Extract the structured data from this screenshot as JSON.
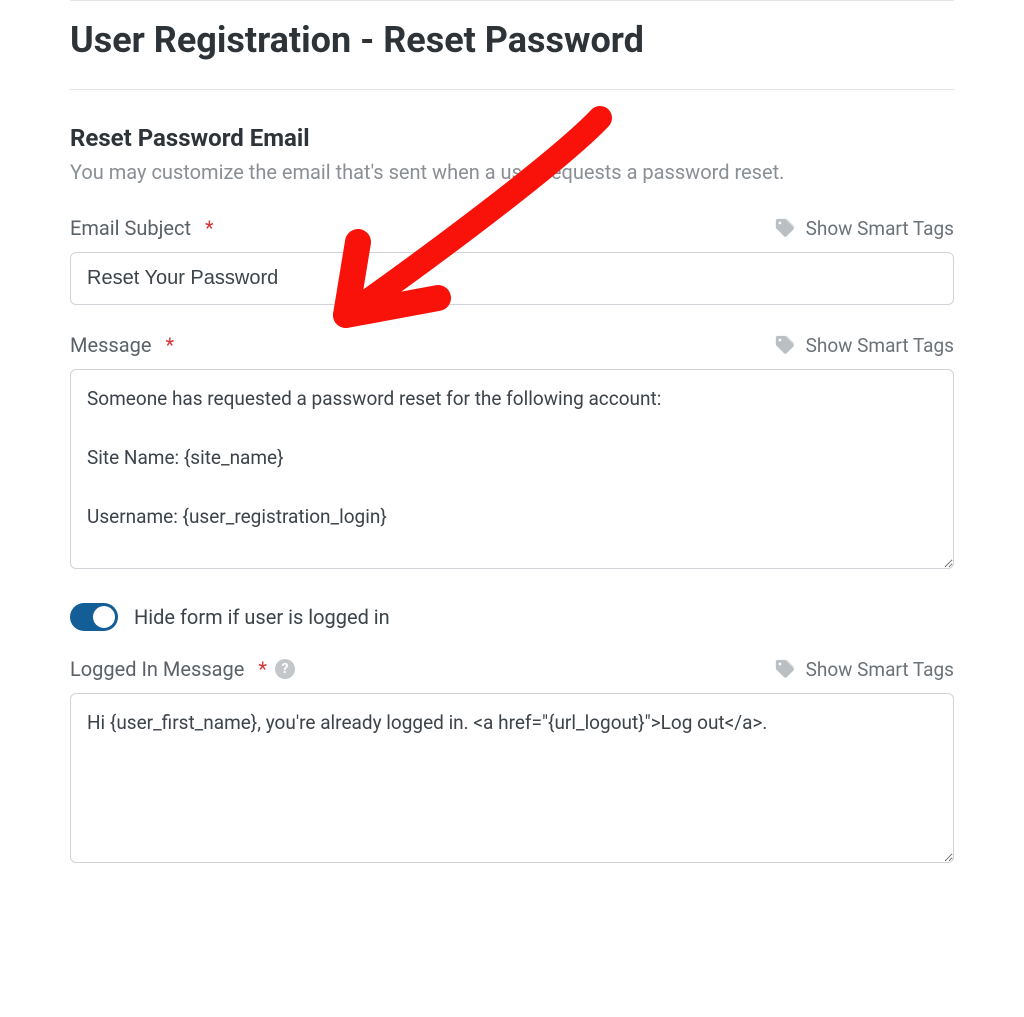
{
  "page": {
    "title": "User Registration - Reset Password"
  },
  "section": {
    "title": "Reset Password Email",
    "description": "You may customize the email that's sent when a user requests a password reset."
  },
  "smart_tags_label": "Show Smart Tags",
  "fields": {
    "email_subject": {
      "label": "Email Subject",
      "value": "Reset Your Password"
    },
    "message": {
      "label": "Message",
      "value": "Someone has requested a password reset for the following account:\n\nSite Name: {site_name}\n\nUsername: {user_registration_login}"
    },
    "hide_toggle": {
      "label": "Hide form if user is logged in",
      "on": true
    },
    "logged_in_message": {
      "label": "Logged In Message",
      "value": "Hi {user_first_name}, you're already logged in. <a href=\"{url_logout}\">Log out</a>."
    }
  }
}
